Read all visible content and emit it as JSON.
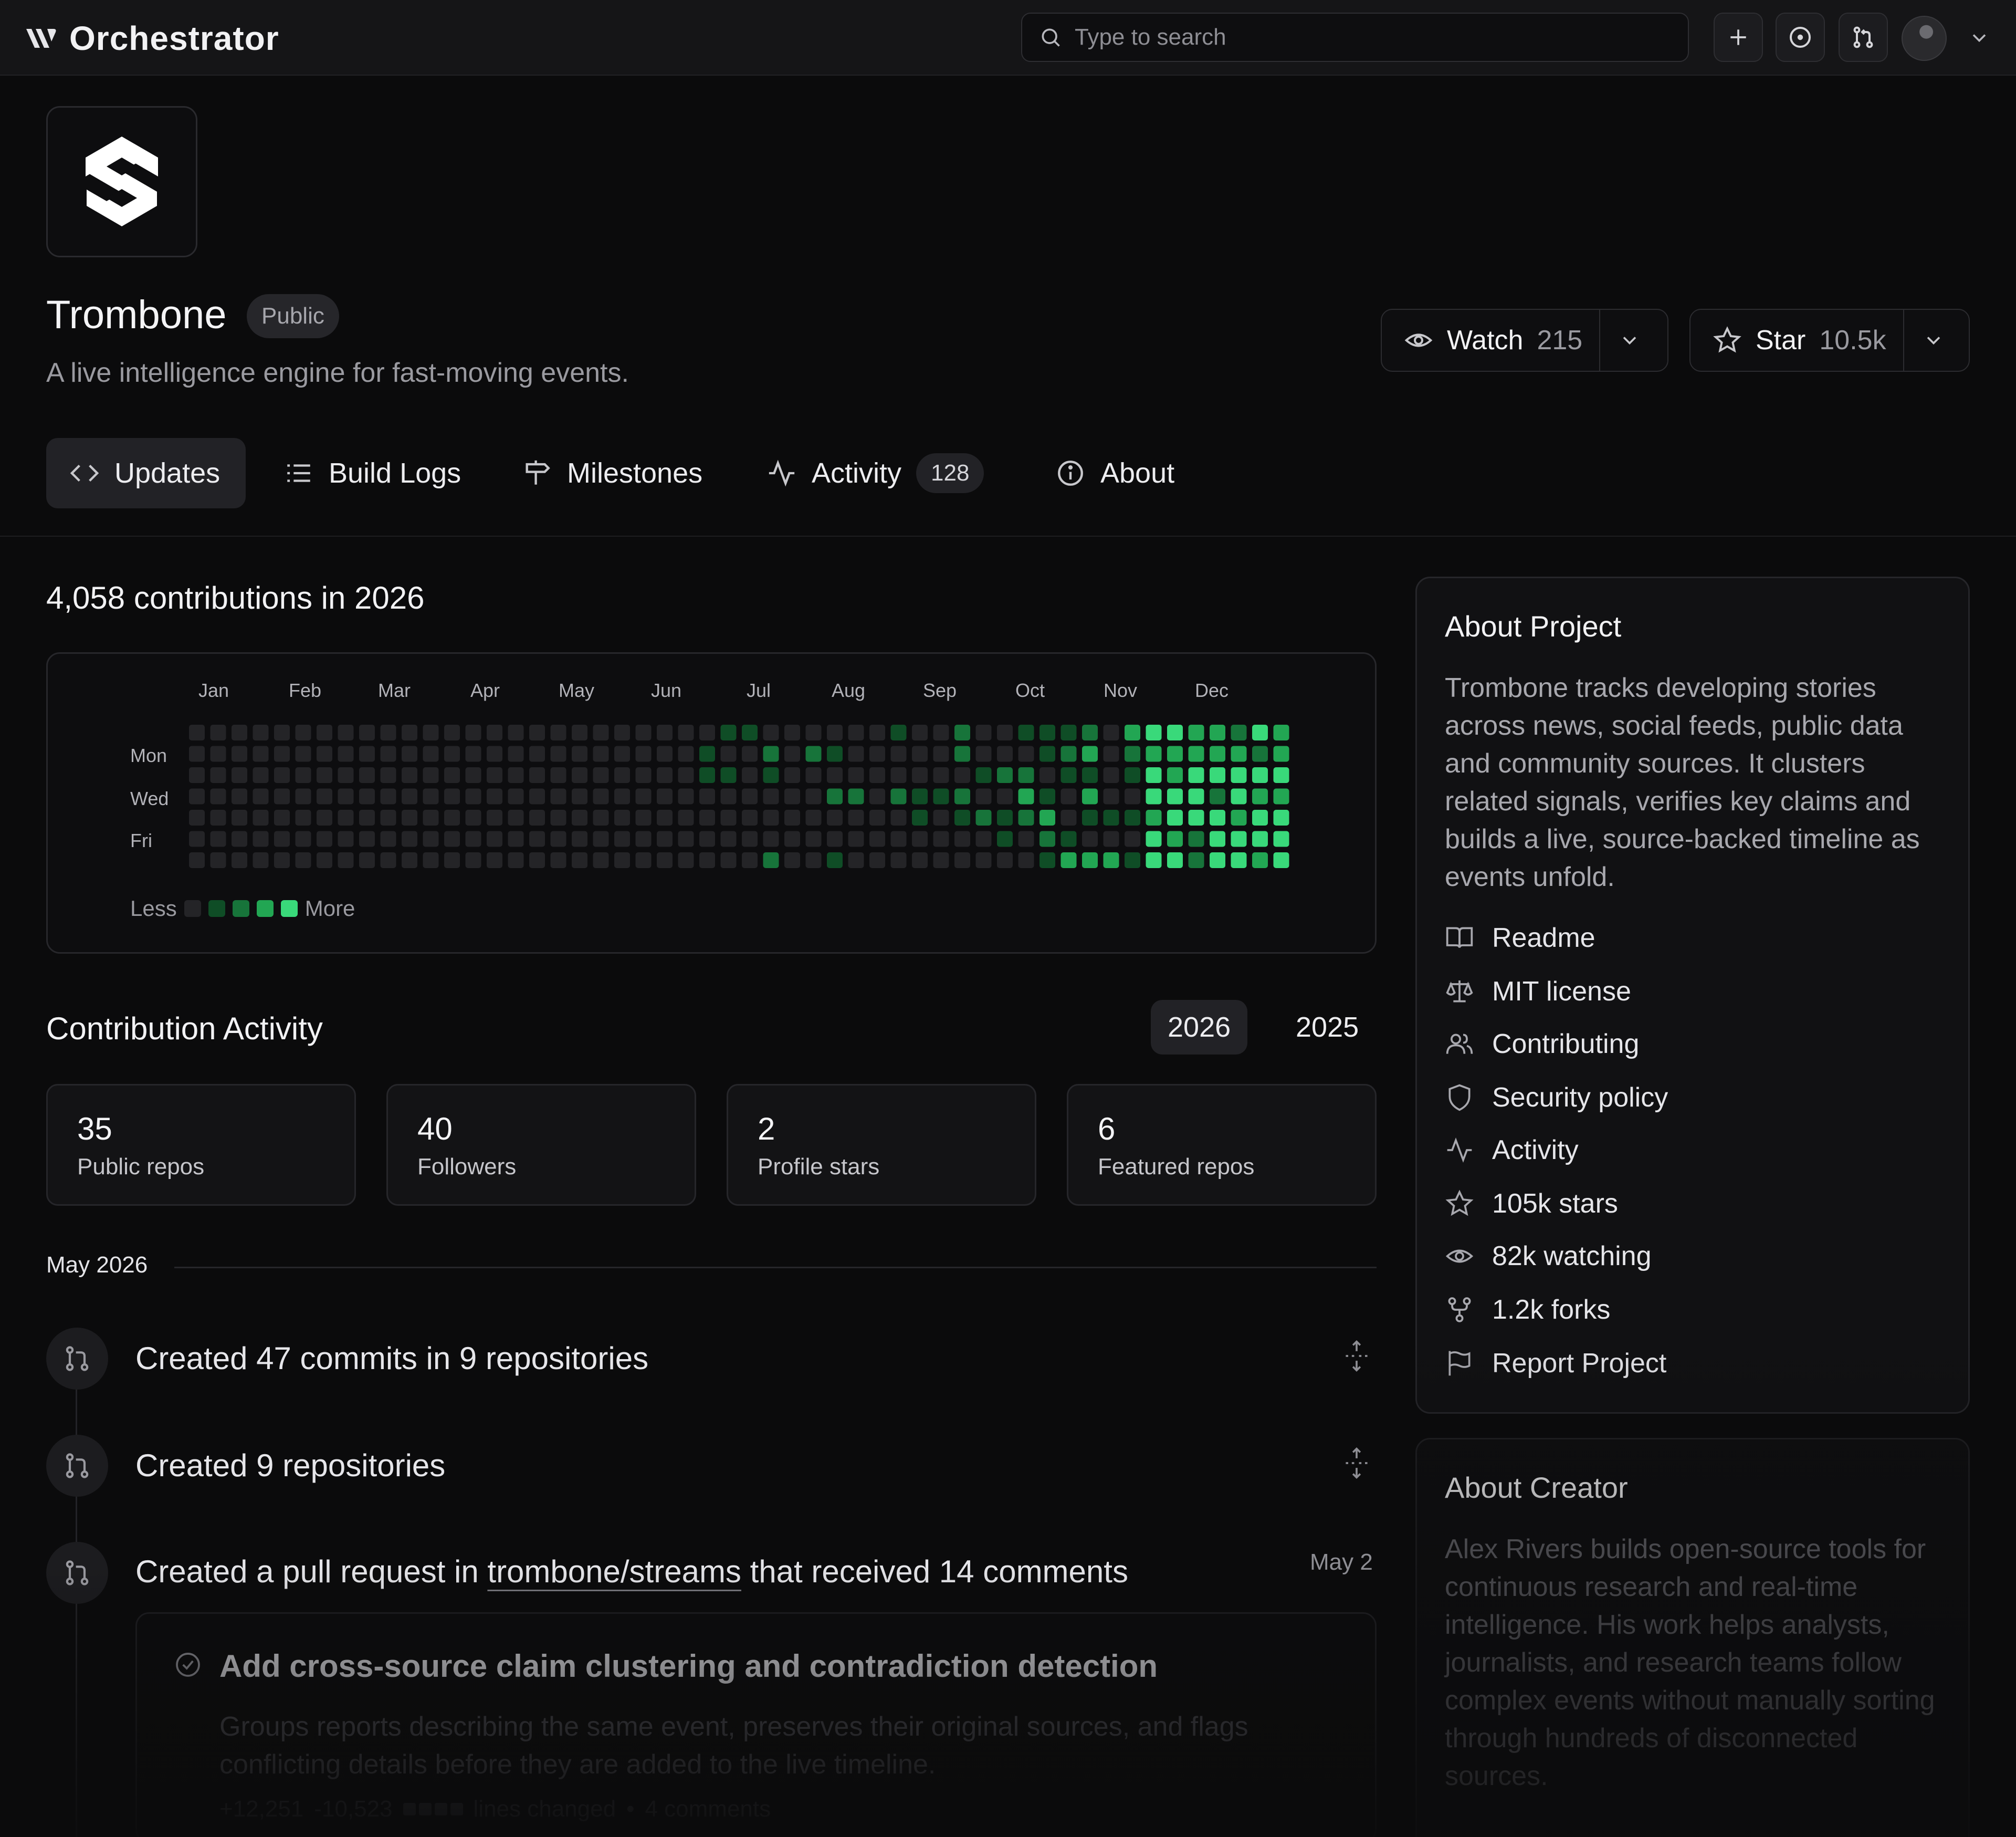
{
  "app": {
    "name": "Orchestrator"
  },
  "search": {
    "placeholder": "Type to search"
  },
  "repo": {
    "name": "Trombone",
    "visibility": "Public",
    "description": "A live intelligence engine for fast-moving events.",
    "watch": {
      "label": "Watch",
      "count": "215"
    },
    "star": {
      "label": "Star",
      "count": "10.5k"
    }
  },
  "tabs": [
    {
      "label": "Updates",
      "icon": "code-icon",
      "active": true
    },
    {
      "label": "Build Logs",
      "icon": "list-icon"
    },
    {
      "label": "Milestones",
      "icon": "signpost-icon"
    },
    {
      "label": "Activity",
      "icon": "pulse-icon",
      "count": "128"
    },
    {
      "label": "About",
      "icon": "info-icon"
    }
  ],
  "contributions": {
    "title": "4,058 contributions in 2026",
    "months": [
      "Jan",
      "Feb",
      "Mar",
      "Apr",
      "May",
      "Jun",
      "Jul",
      "Aug",
      "Sep",
      "Oct",
      "Nov",
      "Dec"
    ],
    "days": [
      "Mon",
      "Wed",
      "Fri"
    ],
    "legend": {
      "less": "Less",
      "more": "More"
    },
    "level_colors": [
      "#242427",
      "#0f4d26",
      "#17743a",
      "#22a653",
      "#39d97a"
    ]
  },
  "activity": {
    "title": "Contribution Activity",
    "years": [
      "2026",
      "2025"
    ],
    "selected_year": "2026",
    "stats": [
      {
        "value": "35",
        "label": "Public repos"
      },
      {
        "value": "40",
        "label": "Followers"
      },
      {
        "value": "2",
        "label": "Profile stars"
      },
      {
        "value": "6",
        "label": "Featured repos"
      }
    ],
    "month_header": "May 2026",
    "timeline": [
      {
        "text": "Created 47 commits in 9 repositories"
      },
      {
        "text": "Created 9 repositories"
      },
      {
        "pre": "Created a pull request in",
        "link": "trombone/streams",
        "post": "that received 14 comments",
        "date": "May 2"
      }
    ],
    "pull_request": {
      "title": "Add cross-source claim clustering and contradiction detection",
      "body": "Groups reports describing the same event, preserves their original sources, and flags conflicting details before they are added to the live timeline.",
      "additions": "+12,251",
      "deletions": "-10,523",
      "lines_label": "lines changed",
      "comments": "4 comments"
    }
  },
  "about_project": {
    "title": "About Project",
    "text": "Trombone tracks developing stories across news, social feeds, public data and community sources. It clusters related signals, verifies key claims and builds a live, source-backed timeline as events unfold.",
    "links": [
      {
        "label": "Readme",
        "icon": "book-icon"
      },
      {
        "label": "MIT license",
        "icon": "scale-icon"
      },
      {
        "label": "Contributing",
        "icon": "people-icon"
      },
      {
        "label": "Security policy",
        "icon": "shield-icon"
      },
      {
        "label": "Activity",
        "icon": "pulse-icon"
      },
      {
        "label": "105k stars",
        "icon": "star-icon"
      },
      {
        "label": "82k watching",
        "icon": "eye-icon"
      },
      {
        "label": "1.2k forks",
        "icon": "fork-icon"
      },
      {
        "label": "Report Project",
        "icon": "flag-icon"
      }
    ]
  },
  "about_creator": {
    "title": "About Creator",
    "text": "Alex Rivers builds open-source tools for continuous research and real-time intelligence. His work helps analysts, journalists, and research teams follow complex events without manually sorting through hundreds of disconnected sources."
  }
}
